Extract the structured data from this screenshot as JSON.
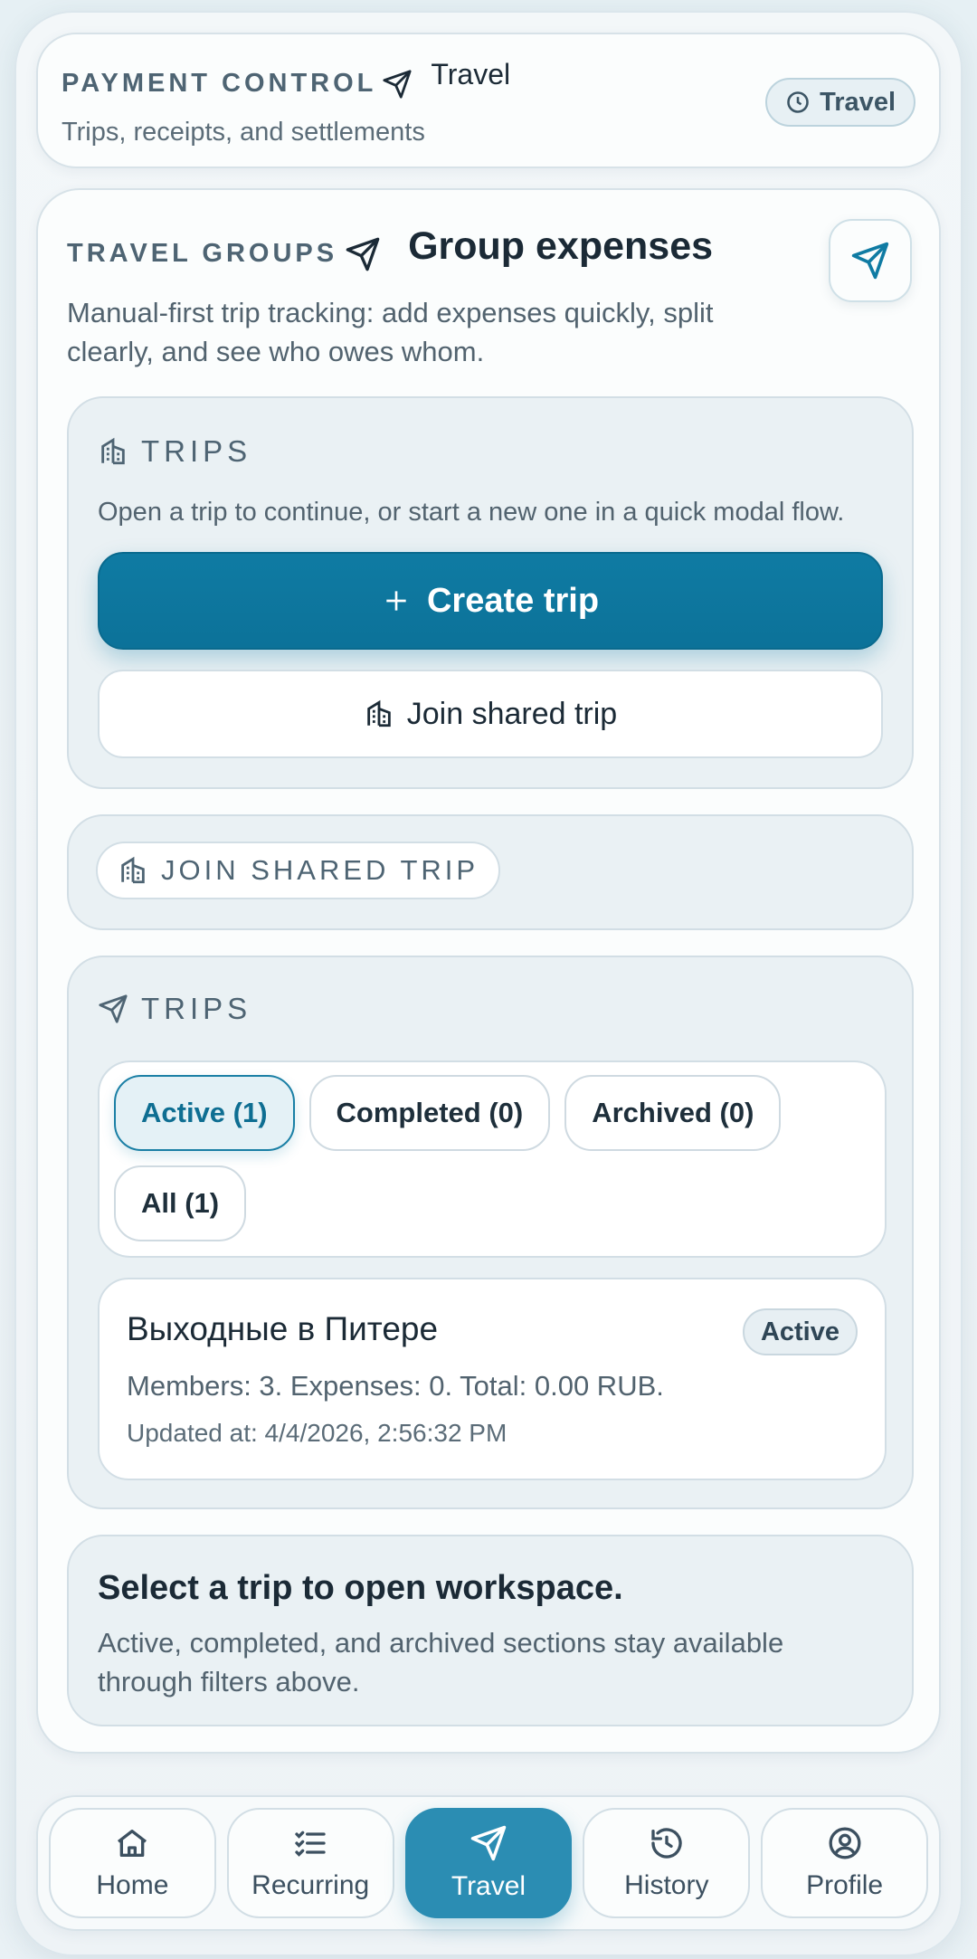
{
  "header": {
    "eyebrow": "PAYMENT CONTROL",
    "title": "Travel",
    "subtitle": "Trips, receipts, and settlements",
    "badge": "Travel"
  },
  "groups": {
    "eyebrow": "TRAVEL GROUPS",
    "title": "Group expenses",
    "description": "Manual-first trip tracking: add expenses quickly, split clearly, and see who owes whom."
  },
  "trips_panel": {
    "label": "TRIPS",
    "description": "Open a trip to continue, or start a new one in a quick modal flow.",
    "create_button": "Create trip",
    "join_button": "Join shared trip"
  },
  "join_section": {
    "label": "JOIN SHARED TRIP"
  },
  "trips_list": {
    "label": "TRIPS",
    "filters": [
      {
        "label": "Active (1)",
        "active": true
      },
      {
        "label": "Completed (0)",
        "active": false
      },
      {
        "label": "Archived (0)",
        "active": false
      },
      {
        "label": "All (1)",
        "active": false
      }
    ],
    "trip": {
      "name": "Выходные в Питере",
      "status": "Active",
      "meta": "Members: 3. Expenses: 0. Total: 0.00 RUB.",
      "updated": "Updated at: 4/4/2026, 2:56:32 PM"
    }
  },
  "workspace_hint": {
    "title": "Select a trip to open workspace.",
    "description": "Active, completed, and archived sections stay available through filters above."
  },
  "nav": [
    {
      "label": "Home",
      "icon": "home-icon",
      "active": false
    },
    {
      "label": "Recurring",
      "icon": "list-check-icon",
      "active": false
    },
    {
      "label": "Travel",
      "icon": "paper-plane-icon",
      "active": true
    },
    {
      "label": "History",
      "icon": "history-icon",
      "active": false
    },
    {
      "label": "Profile",
      "icon": "user-circle-icon",
      "active": false
    }
  ],
  "colors": {
    "accent": "#0f7ba3",
    "nav_active": "#2b8db3",
    "text": "#1b2a36",
    "muted": "#52636f"
  }
}
